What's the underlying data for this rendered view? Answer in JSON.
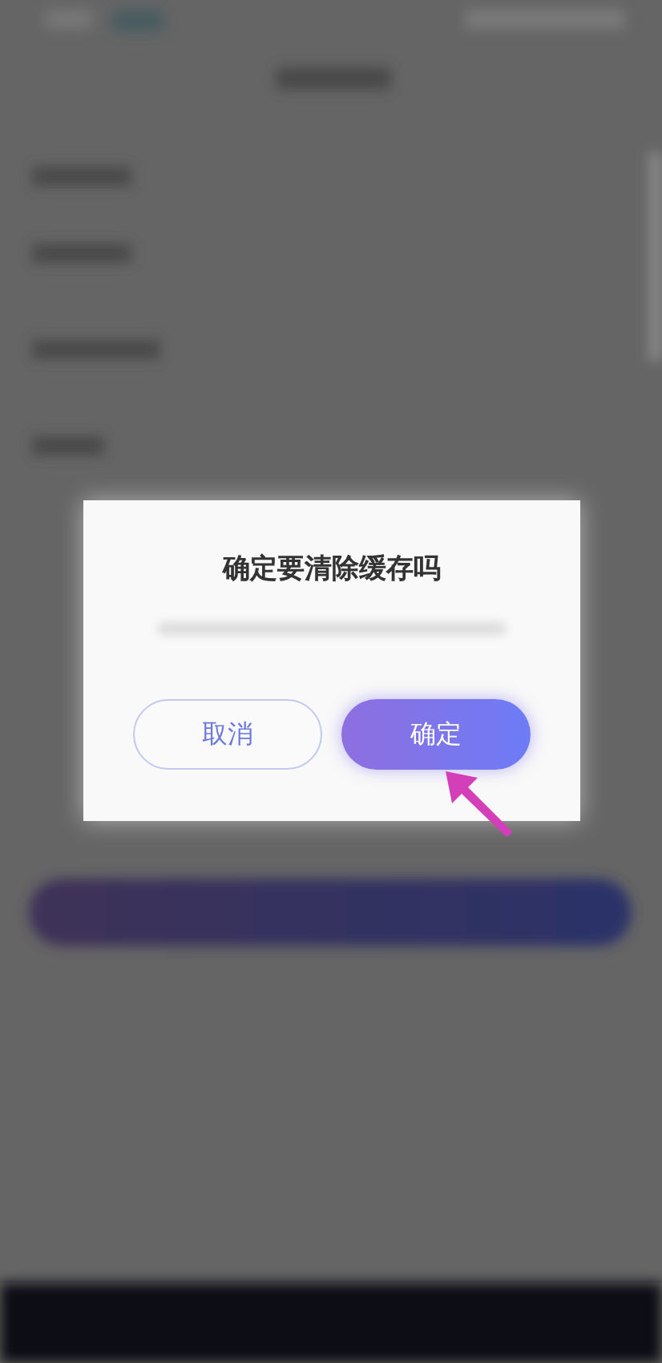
{
  "dialog": {
    "title": "确定要清除缓存吗",
    "buttons": [
      {
        "label": "取消",
        "kind": "secondary"
      },
      {
        "label": "确定",
        "kind": "primary"
      }
    ]
  }
}
